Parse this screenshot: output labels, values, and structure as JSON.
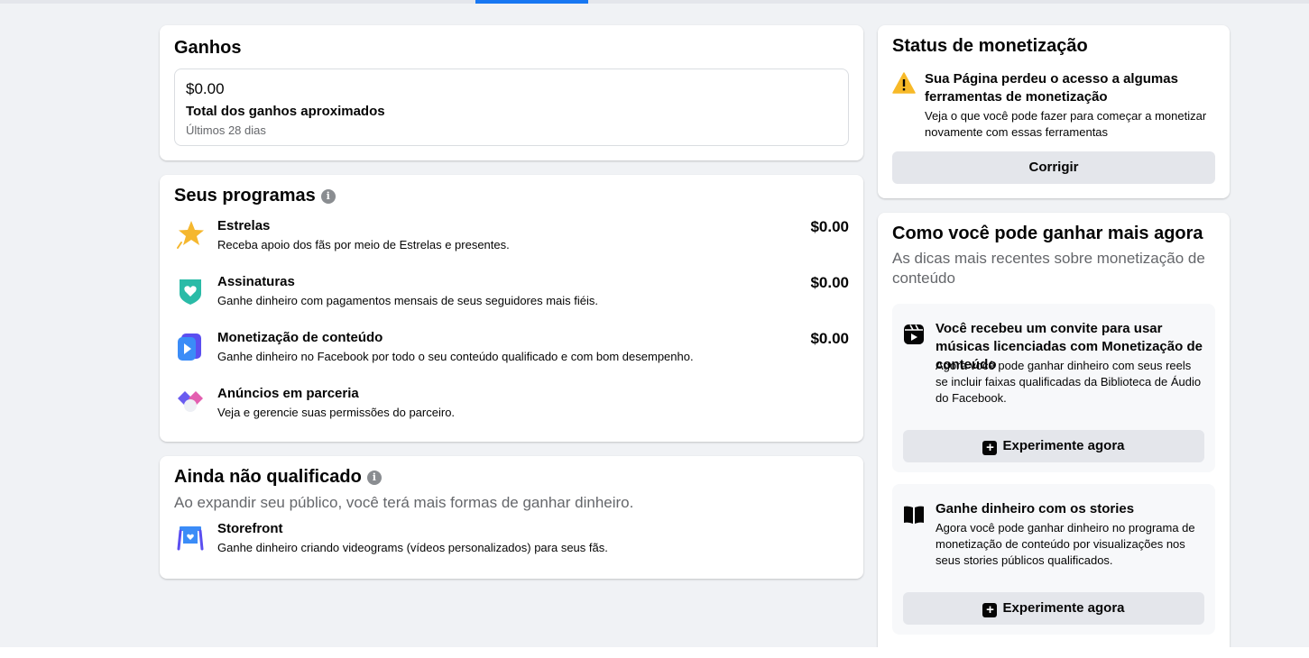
{
  "earnings": {
    "title": "Ganhos",
    "amount": "$0.00",
    "label": "Total dos ganhos aproximados",
    "period": "Últimos 28 dias"
  },
  "programs": {
    "title": "Seus programas",
    "items": [
      {
        "name": "Estrelas",
        "desc": "Receba apoio dos fãs por meio de Estrelas e presentes.",
        "amount": "$0.00",
        "icon": "star-icon"
      },
      {
        "name": "Assinaturas",
        "desc": "Ganhe dinheiro com pagamentos mensais de seus seguidores mais fiéis.",
        "amount": "$0.00",
        "icon": "heart-shield-icon"
      },
      {
        "name": "Monetização de conteúdo",
        "desc": "Ganhe dinheiro no Facebook por todo o seu conteúdo qualificado e com bom desempenho.",
        "amount": "$0.00",
        "icon": "play-icon"
      },
      {
        "name": "Anúncios em parceria",
        "desc": "Veja e gerencie suas permissões do parceiro.",
        "icon": "partnership-icon"
      }
    ]
  },
  "not_qualified": {
    "title": "Ainda não qualificado",
    "subtitle": "Ao expandir seu público, você terá mais formas de ganhar dinheiro.",
    "items": [
      {
        "name": "Storefront",
        "desc": "Ganhe dinheiro criando videograms (vídeos personalizados) para seus fãs.",
        "icon": "storefront-icon"
      }
    ]
  },
  "status": {
    "title": "Status de monetização",
    "warning_title": "Sua Página perdeu o acesso a algumas ferramentas de monetização",
    "warning_desc": "Veja o que você pode fazer para começar a monetizar novamente com essas ferramentas",
    "fix_label": "Corrigir"
  },
  "earn_more": {
    "title": "Como você pode ganhar mais agora",
    "subtitle": "As dicas mais recentes sobre monetização de conteúdo",
    "tips": [
      {
        "title": "Você recebeu um convite para usar músicas licenciadas com Monetização de conteúdo",
        "desc": "Agora você pode ganhar dinheiro com seus reels se incluir faixas qualificadas da Biblioteca de Áudio do Facebook.",
        "button": "Experimente agora",
        "icon": "reels-icon"
      },
      {
        "title": "Ganhe dinheiro com os stories",
        "desc": "Agora você pode ganhar dinheiro no programa de monetização de conteúdo por visualizações nos seus stories públicos qualificados.",
        "button": "Experimente agora",
        "icon": "book-icon"
      }
    ]
  },
  "colors": {
    "background": "#f0f2f5",
    "accent": "#1877f2",
    "button_gray": "#e4e6eb",
    "warning": "#f7b928"
  }
}
